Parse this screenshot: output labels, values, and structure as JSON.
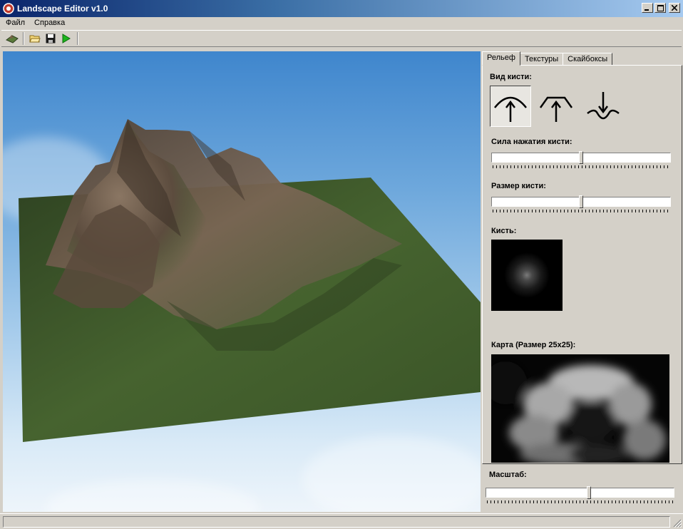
{
  "window": {
    "title": "Landscape Editor v1.0",
    "icon": "app-icon"
  },
  "menu": [
    {
      "label": "Файл"
    },
    {
      "label": "Справка"
    }
  ],
  "toolbar": {
    "buttons": [
      {
        "name": "terrain-icon"
      },
      {
        "name": "open-folder-icon"
      },
      {
        "name": "save-icon"
      },
      {
        "name": "play-icon"
      }
    ]
  },
  "tabs": [
    {
      "label": "Рельеф",
      "active": true
    },
    {
      "label": "Текстуры",
      "active": false
    },
    {
      "label": "Скайбоксы",
      "active": false
    }
  ],
  "relief": {
    "brush_type_label": "Вид кисти:",
    "brush_types": [
      {
        "name": "raise-brush-icon",
        "selected": true
      },
      {
        "name": "flatten-brush-icon",
        "selected": false
      },
      {
        "name": "lower-brush-icon",
        "selected": false
      }
    ],
    "pressure": {
      "label": "Сила нажатия кисти:",
      "value": 0.5
    },
    "size": {
      "label": "Размер кисти:",
      "value": 0.5
    },
    "brush_label": "Кисть:",
    "map_label": "Карта (Размер 25x25):"
  },
  "scale": {
    "label": "Масштаб:",
    "value": 0.55
  },
  "colors": {
    "panel": "#d4d0c8",
    "grass": "#3d5a2a",
    "rock": "#6a5848",
    "sky": "#6ea8dc"
  }
}
